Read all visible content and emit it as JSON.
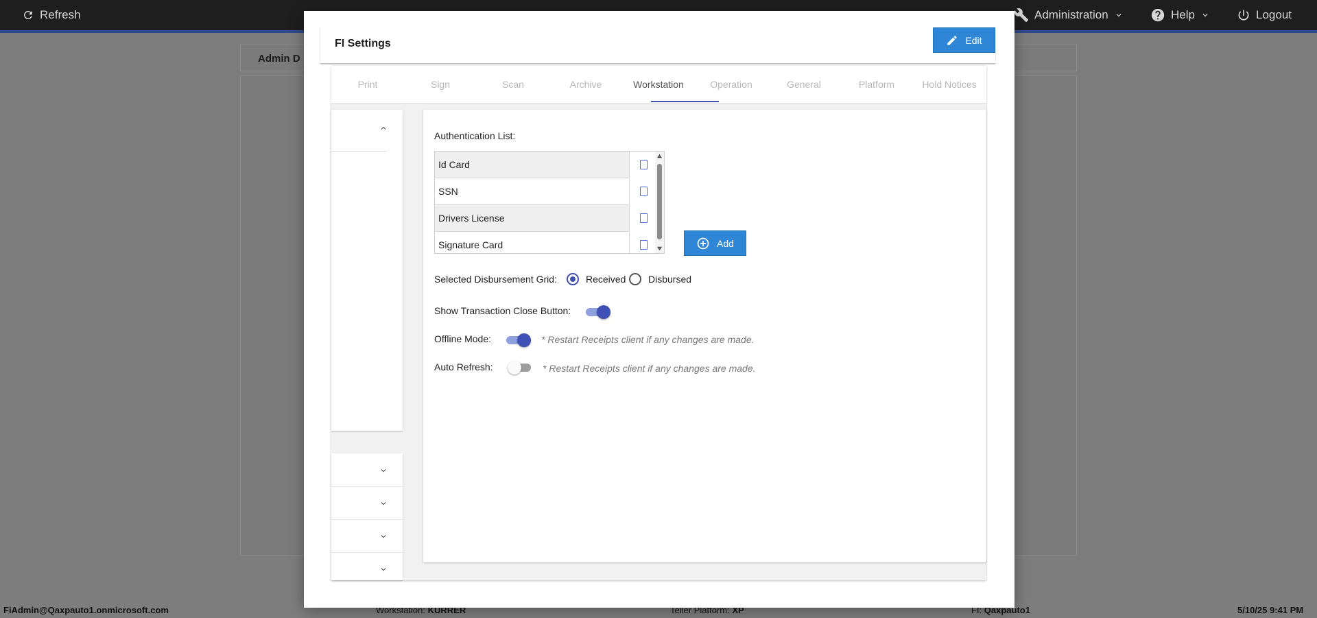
{
  "topbar": {
    "refresh_label": "Refresh",
    "administration_label": "Administration",
    "help_label": "Help",
    "logout_label": "Logout"
  },
  "background": {
    "panel_title_partial": "Admin D"
  },
  "footer": {
    "user": "FiAdmin@Qaxpauto1.onmicrosoft.com",
    "workstation_label": "Workstation:",
    "workstation_value": "KURRER",
    "teller_platform_label": "Teller Platform:",
    "teller_platform_value": "XP",
    "fi_label": "FI:",
    "fi_value": "Qaxpauto1",
    "datetime": "5/10/25 9:41 PM"
  },
  "modal": {
    "title": "FI Settings",
    "edit_label": "Edit"
  },
  "tabs": [
    {
      "label": "Print",
      "active": false
    },
    {
      "label": "Sign",
      "active": false
    },
    {
      "label": "Scan",
      "active": false
    },
    {
      "label": "Archive",
      "active": false
    },
    {
      "label": "Workstation",
      "active": true
    },
    {
      "label": "Operation",
      "active": false
    },
    {
      "label": "General",
      "active": false
    },
    {
      "label": "Platform",
      "active": false
    },
    {
      "label": "Hold Notices",
      "active": false
    }
  ],
  "workstation": {
    "auth_list_label": "Authentication List:",
    "auth_items": [
      {
        "label": "Id Card",
        "checked": false
      },
      {
        "label": "SSN",
        "checked": false
      },
      {
        "label": "Drivers License",
        "checked": false
      },
      {
        "label": "Signature Card",
        "checked": false
      }
    ],
    "add_label": "Add",
    "disbursement_label": "Selected Disbursement Grid:",
    "disbursement_options": [
      {
        "label": "Received",
        "selected": true
      },
      {
        "label": "Disbursed",
        "selected": false
      }
    ],
    "close_button_label": "Show Transaction Close Button:",
    "close_button_on": true,
    "offline_label": "Offline Mode:",
    "offline_on": true,
    "offline_note": "* Restart Receipts client if any changes are made.",
    "auto_refresh_label": "Auto Refresh:",
    "auto_refresh_on": false,
    "auto_refresh_note": "* Restart Receipts client if any changes are made."
  },
  "colors": {
    "accent": "#3f51b5",
    "button": "#2f86d6",
    "topbar": "#1e1e1e"
  }
}
